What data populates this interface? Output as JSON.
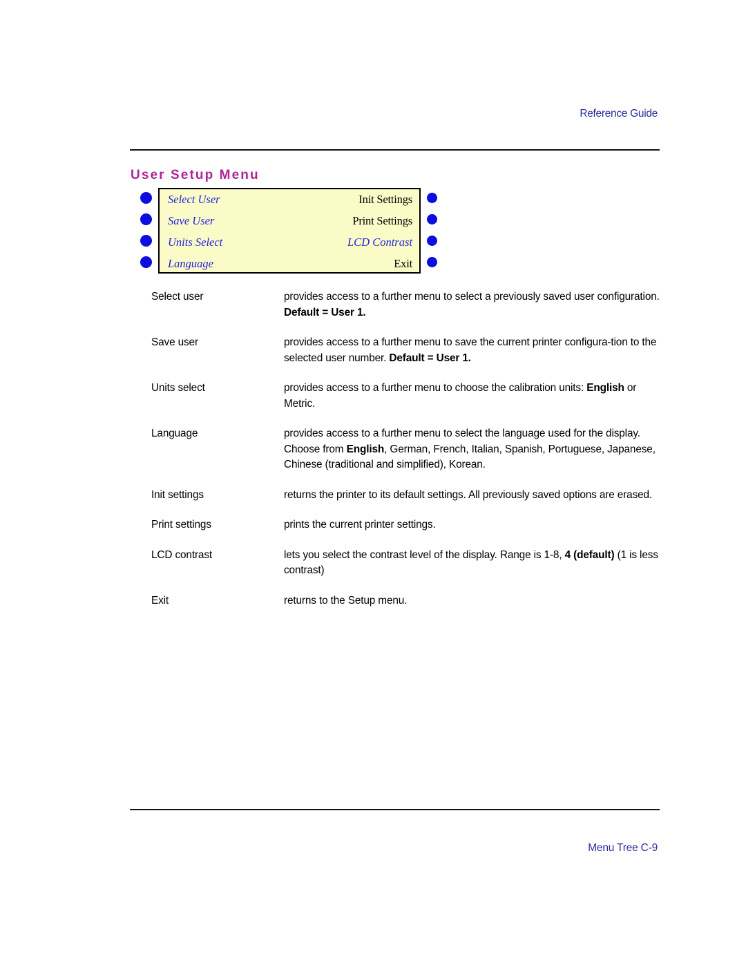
{
  "page": {
    "header_right": "Reference Guide",
    "footer_right": "Menu Tree  C-9",
    "section_title": "User Setup Menu"
  },
  "colors": {
    "header_footer_text": "#2b2b9e",
    "section_title": "#b0229a",
    "menu_box_fill": "#fbfbc8",
    "menu_box_border": "#000000",
    "menu_item_blue": "#2222dd",
    "bullet_dot": "#0d0ddd",
    "rule": "#111111"
  },
  "menu_diagram": {
    "rows": [
      {
        "left_label": "Select User",
        "left_style": "blue",
        "right_label": "Init Settings",
        "right_style": "black"
      },
      {
        "left_label": "Save User",
        "left_style": "blue",
        "right_label": "Print Settings",
        "right_style": "black"
      },
      {
        "left_label": "Units Select",
        "left_style": "blue",
        "right_label": "LCD Contrast",
        "right_style": "blue"
      },
      {
        "left_label": "Language",
        "left_style": "blue",
        "right_label": "Exit",
        "right_style": "black"
      }
    ],
    "left_dot_count": 4,
    "right_dot_count": 4
  },
  "definitions": [
    {
      "term": "Select user",
      "desc_html": "provides access to a further menu to select a previously saved user configuration. <b>Default = User 1.</b>"
    },
    {
      "term": "Save user",
      "desc_html": "provides access to a further menu to save the current printer configura-tion to the selected user number. <b>Default = User 1.</b>"
    },
    {
      "term": "Units select",
      "desc_html": "provides access to a further menu to choose the calibration units: <b>English</b> or Metric."
    },
    {
      "term": "Language",
      "desc_html": "provides access to a further menu to select the language used for the display. Choose from <b>English</b>, German, French, Italian, Spanish, Portuguese, Japanese, Chinese (traditional and simplified), Korean."
    },
    {
      "term": "Init settings",
      "desc_html": "returns the printer to its default settings. All previously saved options are erased."
    },
    {
      "term": "Print settings",
      "desc_html": "prints the current printer settings."
    },
    {
      "term": "LCD contrast",
      "desc_html": "lets you select the contrast level of the display. Range is 1-8, <b>4 (default)</b>  (1 is less contrast)"
    },
    {
      "term": "Exit",
      "desc_html": "returns to the Setup menu."
    }
  ]
}
